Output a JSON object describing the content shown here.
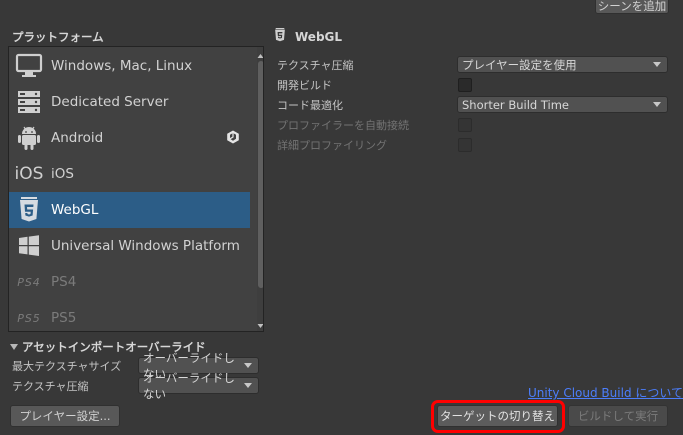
{
  "header": {
    "add_scene_label": "シーンを追加"
  },
  "platforms": {
    "title": "プラットフォーム",
    "items": [
      {
        "label": "Windows, Mac, Linux",
        "icon": "monitor-icon",
        "selected": false,
        "dim": false
      },
      {
        "label": "Dedicated Server",
        "icon": "server-icon",
        "selected": false,
        "dim": false
      },
      {
        "label": "Android",
        "icon": "android-icon",
        "selected": false,
        "dim": false
      },
      {
        "label": "iOS",
        "icon": "ios-icon",
        "icon_text": "iOS",
        "selected": false,
        "dim": false
      },
      {
        "label": "WebGL",
        "icon": "html5-icon",
        "selected": true,
        "dim": false
      },
      {
        "label": "Universal Windows Platform",
        "icon": "windows-icon",
        "selected": false,
        "dim": false
      },
      {
        "label": "PS4",
        "icon": "ps4-icon",
        "icon_text": "PS4",
        "selected": false,
        "dim": true
      },
      {
        "label": "PS5",
        "icon": "ps5-icon",
        "icon_text": "PS5",
        "selected": false,
        "dim": true
      }
    ]
  },
  "webgl": {
    "title": "WebGL",
    "settings": [
      {
        "label": "テクスチャ圧縮",
        "type": "dropdown",
        "value": "プレイヤー設定を使用",
        "dim": false
      },
      {
        "label": "開発ビルド",
        "type": "checkbox",
        "checked": false,
        "dim": false
      },
      {
        "label": "コード最適化",
        "type": "dropdown",
        "value": "Shorter Build Time",
        "dim": false
      },
      {
        "label": "プロファイラーを自動接続",
        "type": "checkbox",
        "checked": false,
        "dim": true
      },
      {
        "label": "詳細プロファイリング",
        "type": "checkbox",
        "checked": false,
        "dim": true
      }
    ]
  },
  "asset_overrides": {
    "title": "アセットインポートオーバーライド",
    "max_texture_size_label": "最大テクスチャサイズ",
    "max_texture_size_value": "オーバーライドしない",
    "texture_compression_label": "テクスチャ圧縮",
    "texture_compression_value": "オーバーライドしない"
  },
  "footer": {
    "cloud_build_link": "Unity Cloud Build について",
    "player_settings_label": "プレイヤー設定...",
    "switch_platform_label": "ターゲットの切り替え",
    "build_and_run_label": "ビルドして実行"
  },
  "colors": {
    "selection": "#2c5d87",
    "highlight": "#ff0000",
    "link": "#4c7efc"
  }
}
